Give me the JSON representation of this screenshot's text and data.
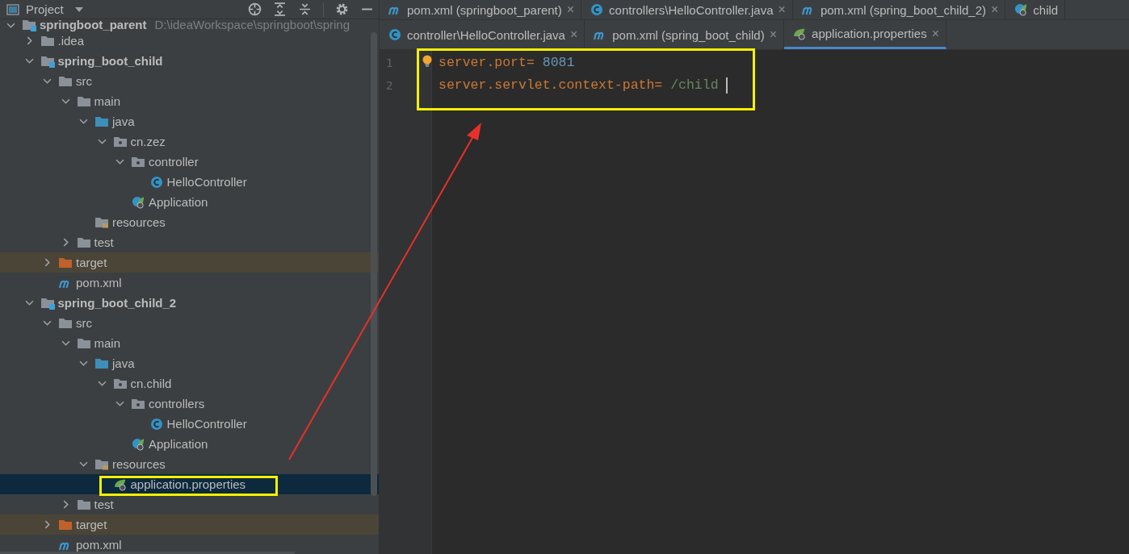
{
  "project_panel": {
    "title": "Project"
  },
  "tree": [
    {
      "label": "springboot_parent",
      "path": "D:\\ideaWorkspace\\springboot\\spring",
      "kind": "module",
      "expanded": true,
      "selected": false,
      "children": [
        {
          "label": ".idea",
          "kind": "folder",
          "expanded": false,
          "selected": false
        },
        {
          "label": "spring_boot_child",
          "kind": "module",
          "expanded": true,
          "selected": false,
          "children": [
            {
              "label": "src",
              "kind": "folder",
              "expanded": true,
              "selected": false,
              "children": [
                {
                  "label": "main",
                  "kind": "folder",
                  "expanded": true,
                  "selected": false,
                  "children": [
                    {
                      "label": "java",
                      "kind": "source-folder",
                      "expanded": true,
                      "selected": false,
                      "children": [
                        {
                          "label": "cn.zez",
                          "kind": "package",
                          "expanded": true,
                          "selected": false,
                          "children": [
                            {
                              "label": "controller",
                              "kind": "package",
                              "expanded": true,
                              "selected": false,
                              "children": [
                                {
                                  "label": "HelloController",
                                  "kind": "class",
                                  "selected": false
                                }
                              ]
                            },
                            {
                              "label": "Application",
                              "kind": "spring-class",
                              "selected": false
                            }
                          ]
                        }
                      ]
                    },
                    {
                      "label": "resources",
                      "kind": "resources-folder",
                      "selected": false
                    }
                  ]
                },
                {
                  "label": "test",
                  "kind": "folder",
                  "expanded": false,
                  "selected": false
                }
              ]
            },
            {
              "label": "target",
              "kind": "excluded-folder",
              "expanded": false,
              "selected": false
            },
            {
              "label": "pom.xml",
              "kind": "maven",
              "selected": false
            }
          ]
        },
        {
          "label": "spring_boot_child_2",
          "kind": "module",
          "expanded": true,
          "selected": false,
          "children": [
            {
              "label": "src",
              "kind": "folder",
              "expanded": true,
              "selected": false,
              "children": [
                {
                  "label": "main",
                  "kind": "folder",
                  "expanded": true,
                  "selected": false,
                  "children": [
                    {
                      "label": "java",
                      "kind": "source-folder",
                      "expanded": true,
                      "selected": false,
                      "children": [
                        {
                          "label": "cn.child",
                          "kind": "package",
                          "expanded": true,
                          "selected": false,
                          "children": [
                            {
                              "label": "controllers",
                              "kind": "package",
                              "expanded": true,
                              "selected": false,
                              "children": [
                                {
                                  "label": "HelloController",
                                  "kind": "class",
                                  "selected": false
                                }
                              ]
                            },
                            {
                              "label": "Application",
                              "kind": "spring-class",
                              "selected": false
                            }
                          ]
                        }
                      ]
                    },
                    {
                      "label": "resources",
                      "kind": "resources-folder",
                      "expanded": true,
                      "selected": false,
                      "children": [
                        {
                          "label": "application.properties",
                          "kind": "properties",
                          "selected": true
                        }
                      ]
                    }
                  ]
                },
                {
                  "label": "test",
                  "kind": "folder",
                  "expanded": false,
                  "selected": false
                }
              ]
            },
            {
              "label": "target",
              "kind": "excluded-folder",
              "expanded": false,
              "selected": false
            },
            {
              "label": "pom.xml",
              "kind": "maven",
              "selected": false
            }
          ]
        }
      ]
    }
  ],
  "tab_rows": [
    [
      {
        "label": "pom.xml (springboot_parent)",
        "kind": "maven",
        "selected": false,
        "closable": true
      },
      {
        "label": "controllers\\HelloController.java",
        "kind": "class",
        "selected": false,
        "closable": true
      },
      {
        "label": "pom.xml (spring_boot_child_2)",
        "kind": "maven",
        "selected": false,
        "closable": true
      },
      {
        "label": "child",
        "kind": "spring-class",
        "selected": false,
        "closable": false
      }
    ],
    [
      {
        "label": "controller\\HelloController.java",
        "kind": "class",
        "selected": false,
        "closable": true
      },
      {
        "label": "pom.xml (spring_boot_child)",
        "kind": "maven",
        "selected": false,
        "closable": true
      },
      {
        "label": "application.properties",
        "kind": "properties",
        "selected": true,
        "closable": true
      }
    ]
  ],
  "close_glyph": "×",
  "editor": {
    "lines": [
      {
        "number": "1",
        "key": "server.port",
        "sep": "=",
        "value": " 8081",
        "kind": "number"
      },
      {
        "number": "2",
        "key": "server.servlet.context-path",
        "sep": "=",
        "value": " /child",
        "kind": "string"
      }
    ]
  }
}
